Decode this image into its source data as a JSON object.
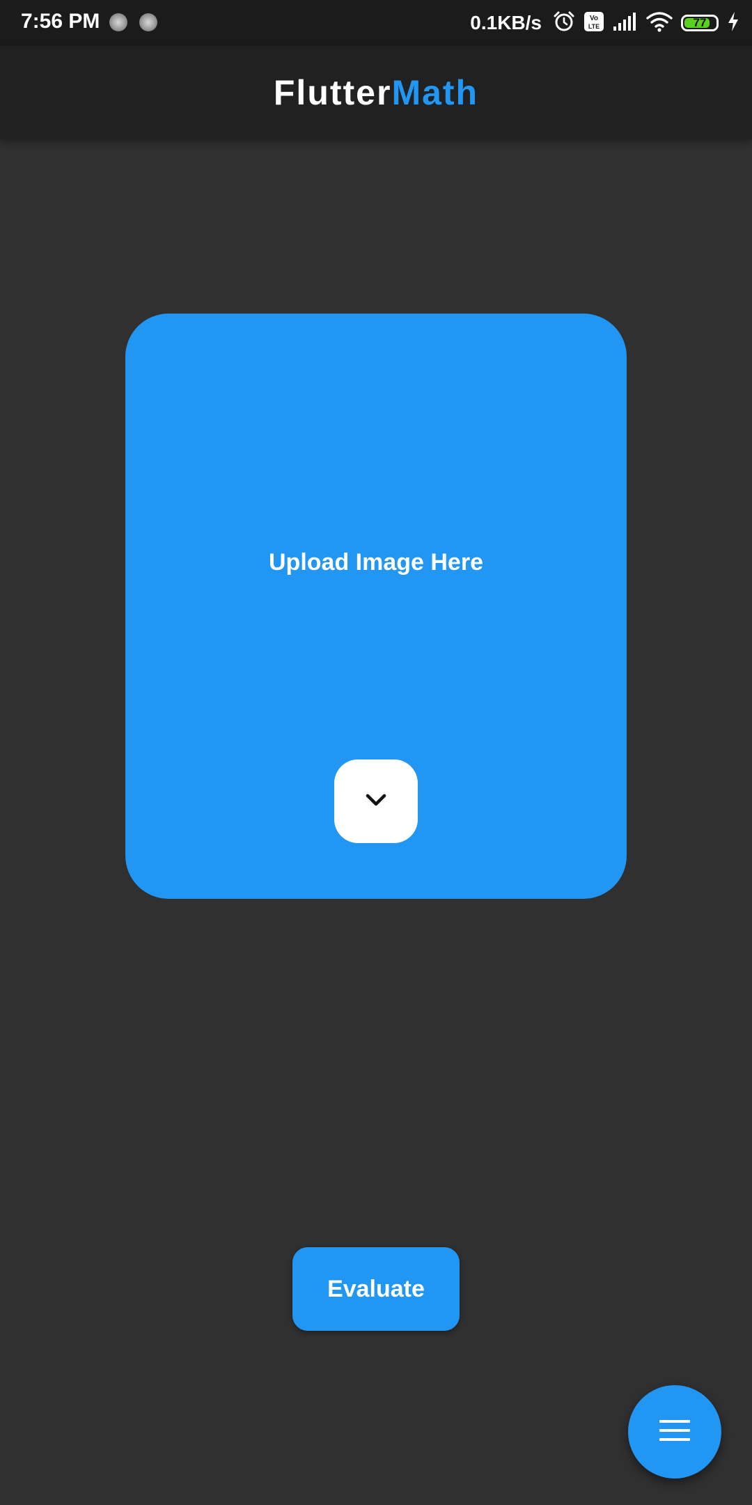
{
  "status_bar": {
    "time": "7:56 PM",
    "net_speed": "0.1KB/s",
    "battery": "77",
    "icons": [
      "notification-dot-icon",
      "notification-dot-icon",
      "alarm-icon",
      "volte-icon",
      "signal-icon",
      "wifi-icon",
      "battery-icon",
      "charging-icon"
    ]
  },
  "app_bar": {
    "title_part1": "Flutter",
    "title_part2": "Math"
  },
  "upload": {
    "label": "Upload Image Here",
    "expand_icon": "chevron-down-icon"
  },
  "evaluate": {
    "label": "Evaluate"
  },
  "fab": {
    "icon": "menu-icon"
  },
  "colors": {
    "accent": "#2196f3",
    "background": "#303030",
    "app_bar": "#212121",
    "status_bar": "#1b1b1b"
  }
}
